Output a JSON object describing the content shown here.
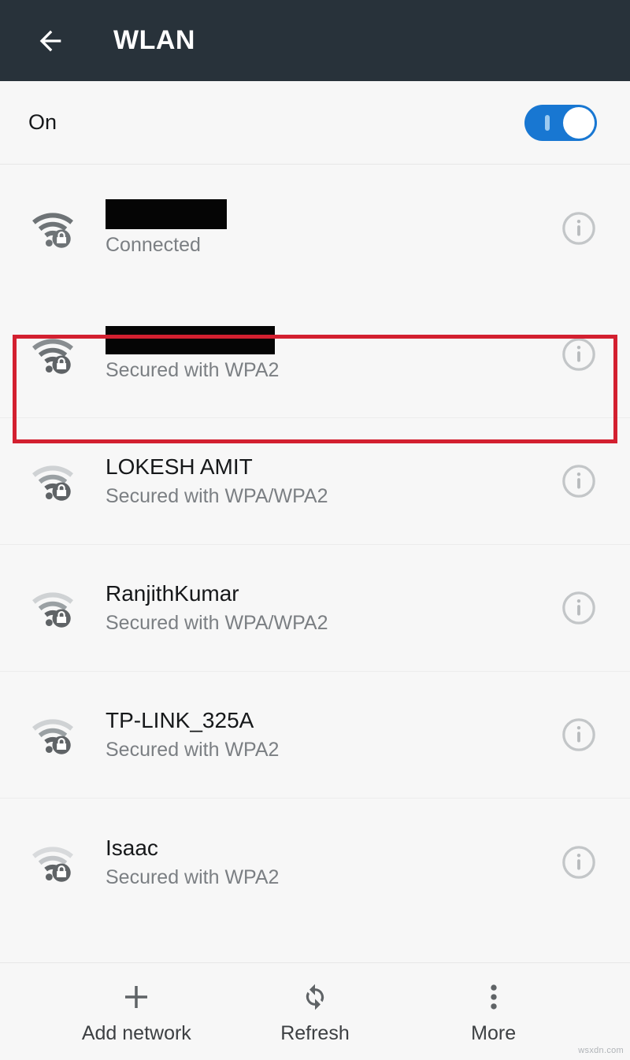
{
  "appbar": {
    "back_icon": "arrow-left-icon",
    "title": "WLAN",
    "background_color": "#28323a",
    "title_color": "#ffffff"
  },
  "wifi_switch_row": {
    "label": "On",
    "toggle_state": "on",
    "toggle_on_color": "#1877d2"
  },
  "highlight": {
    "color": "#d32030",
    "target_row_index": 0
  },
  "networks": [
    {
      "ssid": "",
      "ssid_redacted": true,
      "status": "Connected",
      "secured": true,
      "signal_strength": 3,
      "info_icon": "info-icon",
      "wifi_icon": "wifi-lock-icon",
      "highlighted": true
    },
    {
      "ssid": "",
      "ssid_redacted": true,
      "status": "Secured with WPA2",
      "secured": true,
      "signal_strength": 3,
      "info_icon": "info-icon",
      "wifi_icon": "wifi-lock-icon",
      "highlighted": false
    },
    {
      "ssid": "LOKESH AMIT",
      "ssid_redacted": false,
      "status": "Secured with WPA/WPA2",
      "secured": true,
      "signal_strength": 2,
      "info_icon": "info-icon",
      "wifi_icon": "wifi-lock-icon",
      "highlighted": false
    },
    {
      "ssid": "RanjithKumar",
      "ssid_redacted": false,
      "status": "Secured with WPA/WPA2",
      "secured": true,
      "signal_strength": 2,
      "info_icon": "info-icon",
      "wifi_icon": "wifi-lock-icon",
      "highlighted": false
    },
    {
      "ssid": "TP-LINK_325A",
      "ssid_redacted": false,
      "status": "Secured with WPA2",
      "secured": true,
      "signal_strength": 2,
      "info_icon": "info-icon",
      "wifi_icon": "wifi-lock-icon",
      "highlighted": false
    },
    {
      "ssid": "Isaac",
      "ssid_redacted": false,
      "status": "Secured with WPA2",
      "secured": true,
      "signal_strength": 1,
      "info_icon": "info-icon",
      "wifi_icon": "wifi-lock-icon",
      "highlighted": false
    }
  ],
  "bottom_bar": {
    "actions": [
      {
        "label": "Add network",
        "icon": "plus-icon"
      },
      {
        "label": "Refresh",
        "icon": "refresh-icon"
      },
      {
        "label": "More",
        "icon": "overflow-menu-icon"
      }
    ]
  },
  "watermark": {
    "text": "wsxdn.com"
  }
}
